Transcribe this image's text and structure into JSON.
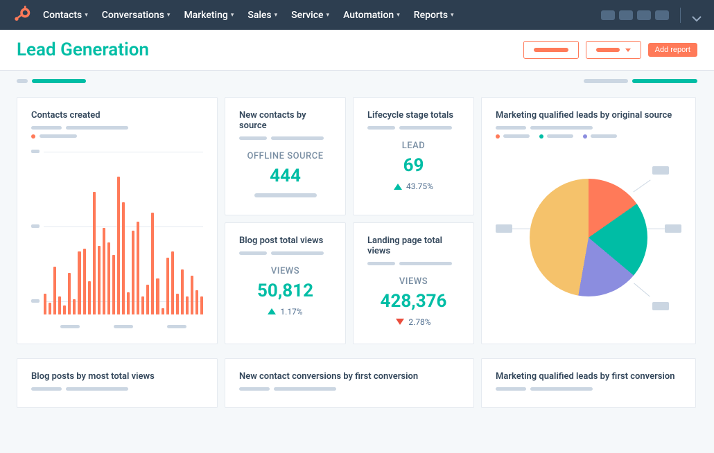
{
  "nav": {
    "items": [
      "Contacts",
      "Conversations",
      "Marketing",
      "Sales",
      "Service",
      "Automation",
      "Reports"
    ]
  },
  "header": {
    "title": "Lead Generation",
    "add_report": "Add report"
  },
  "cards": {
    "contacts_created": {
      "title": "Contacts created"
    },
    "new_contacts_source": {
      "title": "New contacts by source",
      "label": "OFFLINE SOURCE",
      "value": "444"
    },
    "lifecycle_totals": {
      "title": "Lifecycle stage totals",
      "label": "LEAD",
      "value": "69",
      "delta": "43.75%"
    },
    "mql_source": {
      "title": "Marketing qualified leads by original source"
    },
    "blog_views": {
      "title": "Blog post total views",
      "label": "VIEWS",
      "value": "50,812",
      "delta": "1.17%"
    },
    "landing_views": {
      "title": "Landing page total views",
      "label": "VIEWS",
      "value": "428,376",
      "delta": "2.78%"
    },
    "blog_most_views": {
      "title": "Blog posts by most total views"
    },
    "contact_conv_first": {
      "title": "New contact conversions by first conversion"
    },
    "mql_first_conv": {
      "title": "Marketing qualified leads by first conversion"
    }
  },
  "chart_data": {
    "contacts_created": {
      "type": "bar",
      "title": "Contacts created",
      "ylim": [
        0,
        100
      ],
      "values": [
        14,
        8,
        32,
        12,
        6,
        28,
        10,
        42,
        44,
        22,
        82,
        46,
        58,
        48,
        40,
        92,
        75,
        15,
        56,
        62,
        12,
        20,
        68,
        24,
        4,
        38,
        42,
        14,
        30,
        12,
        26,
        16,
        12
      ]
    },
    "mql_source_pie": {
      "type": "pie",
      "title": "Marketing qualified leads by original source",
      "series": [
        {
          "name": "orange",
          "color": "#ff7a59",
          "value": 15
        },
        {
          "name": "teal",
          "color": "#00bda5",
          "value": 21
        },
        {
          "name": "purple",
          "color": "#8b8ddf",
          "value": 17
        },
        {
          "name": "yellow",
          "color": "#f5c26b",
          "value": 47
        }
      ]
    }
  },
  "colors": {
    "orange": "#ff7a59",
    "teal": "#00bda5",
    "purple": "#8b8ddf",
    "yellow": "#f5c26b"
  }
}
